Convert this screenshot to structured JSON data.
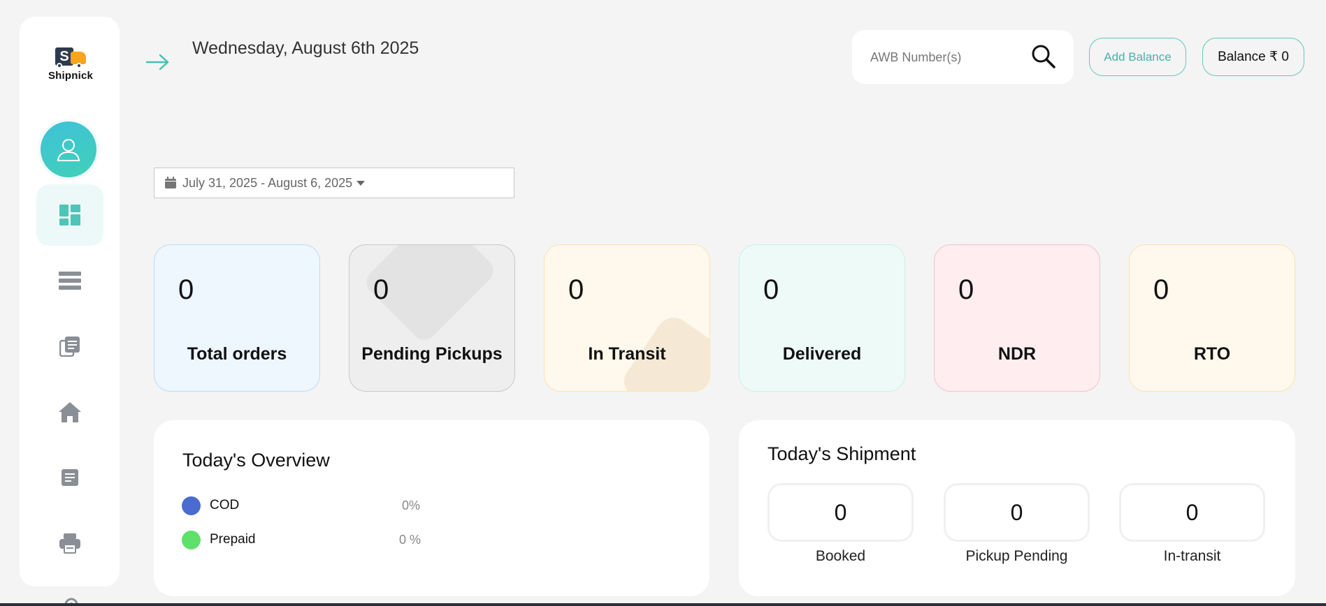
{
  "brand": {
    "name": "Shipnick",
    "logo_letter": "S"
  },
  "header": {
    "date": "Wednesday, August 6th 2025",
    "search": {
      "placeholder": "AWB Number(s)",
      "value": ""
    },
    "add_balance_label": "Add Balance",
    "balance_label": "Balance ₹ 0"
  },
  "sidebar": {
    "items": [
      {
        "name": "dashboard",
        "icon": "dashboard-icon",
        "active": true
      },
      {
        "name": "orders",
        "icon": "menu-list-icon"
      },
      {
        "name": "documents",
        "icon": "documents-icon"
      },
      {
        "name": "home",
        "icon": "home-icon"
      },
      {
        "name": "reports",
        "icon": "report-icon"
      },
      {
        "name": "print",
        "icon": "printer-icon"
      },
      {
        "name": "settings",
        "icon": "gear-icon"
      }
    ]
  },
  "date_range": {
    "label": "July 31, 2025 - August 6, 2025"
  },
  "stats": [
    {
      "value": "0",
      "label": "Total orders"
    },
    {
      "value": "0",
      "label": "Pending Pickups"
    },
    {
      "value": "0",
      "label": "In Transit"
    },
    {
      "value": "0",
      "label": "Delivered"
    },
    {
      "value": "0",
      "label": "NDR"
    },
    {
      "value": "0",
      "label": "RTO"
    }
  ],
  "overview": {
    "title": "Today's Overview",
    "items": [
      {
        "label": "COD",
        "pct": "0%",
        "color": "#4a6bd0"
      },
      {
        "label": "Prepaid",
        "pct": "0 %",
        "color": "#5ee06a"
      }
    ]
  },
  "shipment": {
    "title": "Today's Shipment",
    "items": [
      {
        "value": "0",
        "label": "Booked"
      },
      {
        "value": "0",
        "label": "Pickup Pending"
      },
      {
        "value": "0",
        "label": "In-transit"
      }
    ]
  },
  "colors": {
    "accent": "#45b3a8",
    "background": "#f4f4f4",
    "card_total": "#eef6fe",
    "card_pending": "#eeeeee",
    "card_transit": "#fff8ec",
    "card_delivered": "#eefaf8",
    "card_ndr": "#ffedf0",
    "card_rto": "#fff8ec"
  }
}
